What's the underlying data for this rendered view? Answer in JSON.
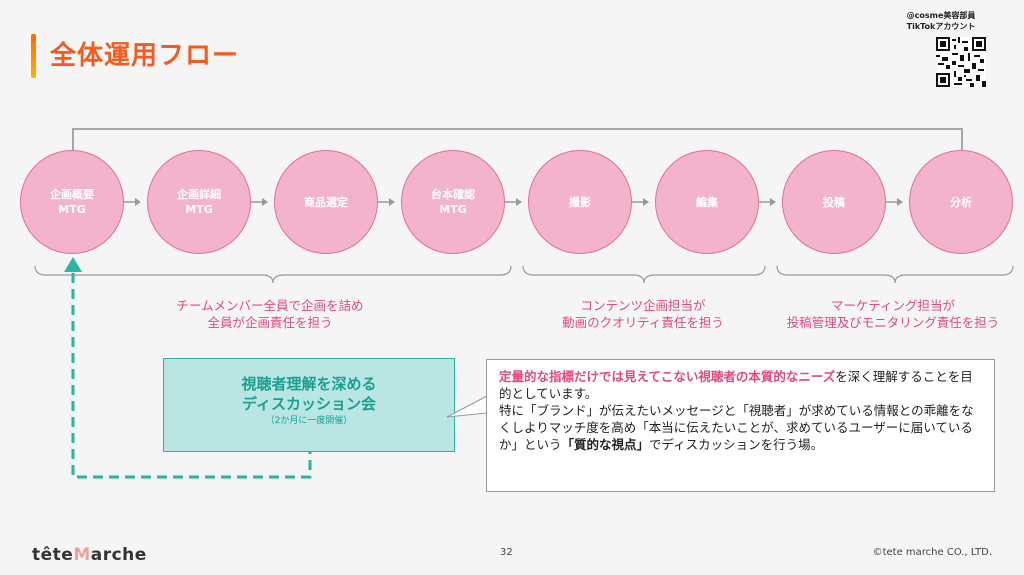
{
  "title": "全体運用フロー",
  "qr": {
    "line1": "@cosme美容部員",
    "line2": "TikTokアカウント",
    "icon": "qr-code-icon"
  },
  "steps": [
    {
      "label": "企画概要\nMTG"
    },
    {
      "label": "企画詳細\nMTG"
    },
    {
      "label": "商品選定"
    },
    {
      "label": "台本確認\nMTG"
    },
    {
      "label": "撮影"
    },
    {
      "label": "編集"
    },
    {
      "label": "投稿"
    },
    {
      "label": "分析"
    }
  ],
  "groups": [
    {
      "line1": "チームメンバー全員で企画を詰め",
      "line2": "全員が企画責任を担う"
    },
    {
      "line1": "コンテンツ企画担当が",
      "line2": "動画のクオリティ責任を担う"
    },
    {
      "line1": "マーケティング担当が",
      "line2": "投稿管理及びモニタリング責任を担う"
    }
  ],
  "discussion": {
    "line1": "視聴者理解を深める",
    "line2": "ディスカッション会",
    "note": "（2か月に一度開催）"
  },
  "callout": {
    "p1_hl": "定量的な指標だけでは見えてこない視聴者の本質的なニーズ",
    "p1_rest": "を深く理解することを目的としています。",
    "p2_a": "特に「ブランド」が伝えたいメッセージと「視聴者」が求めている情報との乖離をなくしよりマッチ度を高め「本当に伝えたいことが、求めているユーザーに届いているか」という",
    "p2_b": "「質的な視点」",
    "p2_c": "でディスカッションを行う場。"
  },
  "footer": {
    "logo_a": "tête",
    "logo_m": "M",
    "logo_b": "arche",
    "page": "32",
    "copyright": "©tete marche CO., LTD."
  },
  "colors": {
    "accent": "#f25c1f",
    "circle": "#f4b3cc",
    "pink_text": "#e4497f",
    "teal": "#27b5a4",
    "teal_bg": "#b9e6e3"
  }
}
